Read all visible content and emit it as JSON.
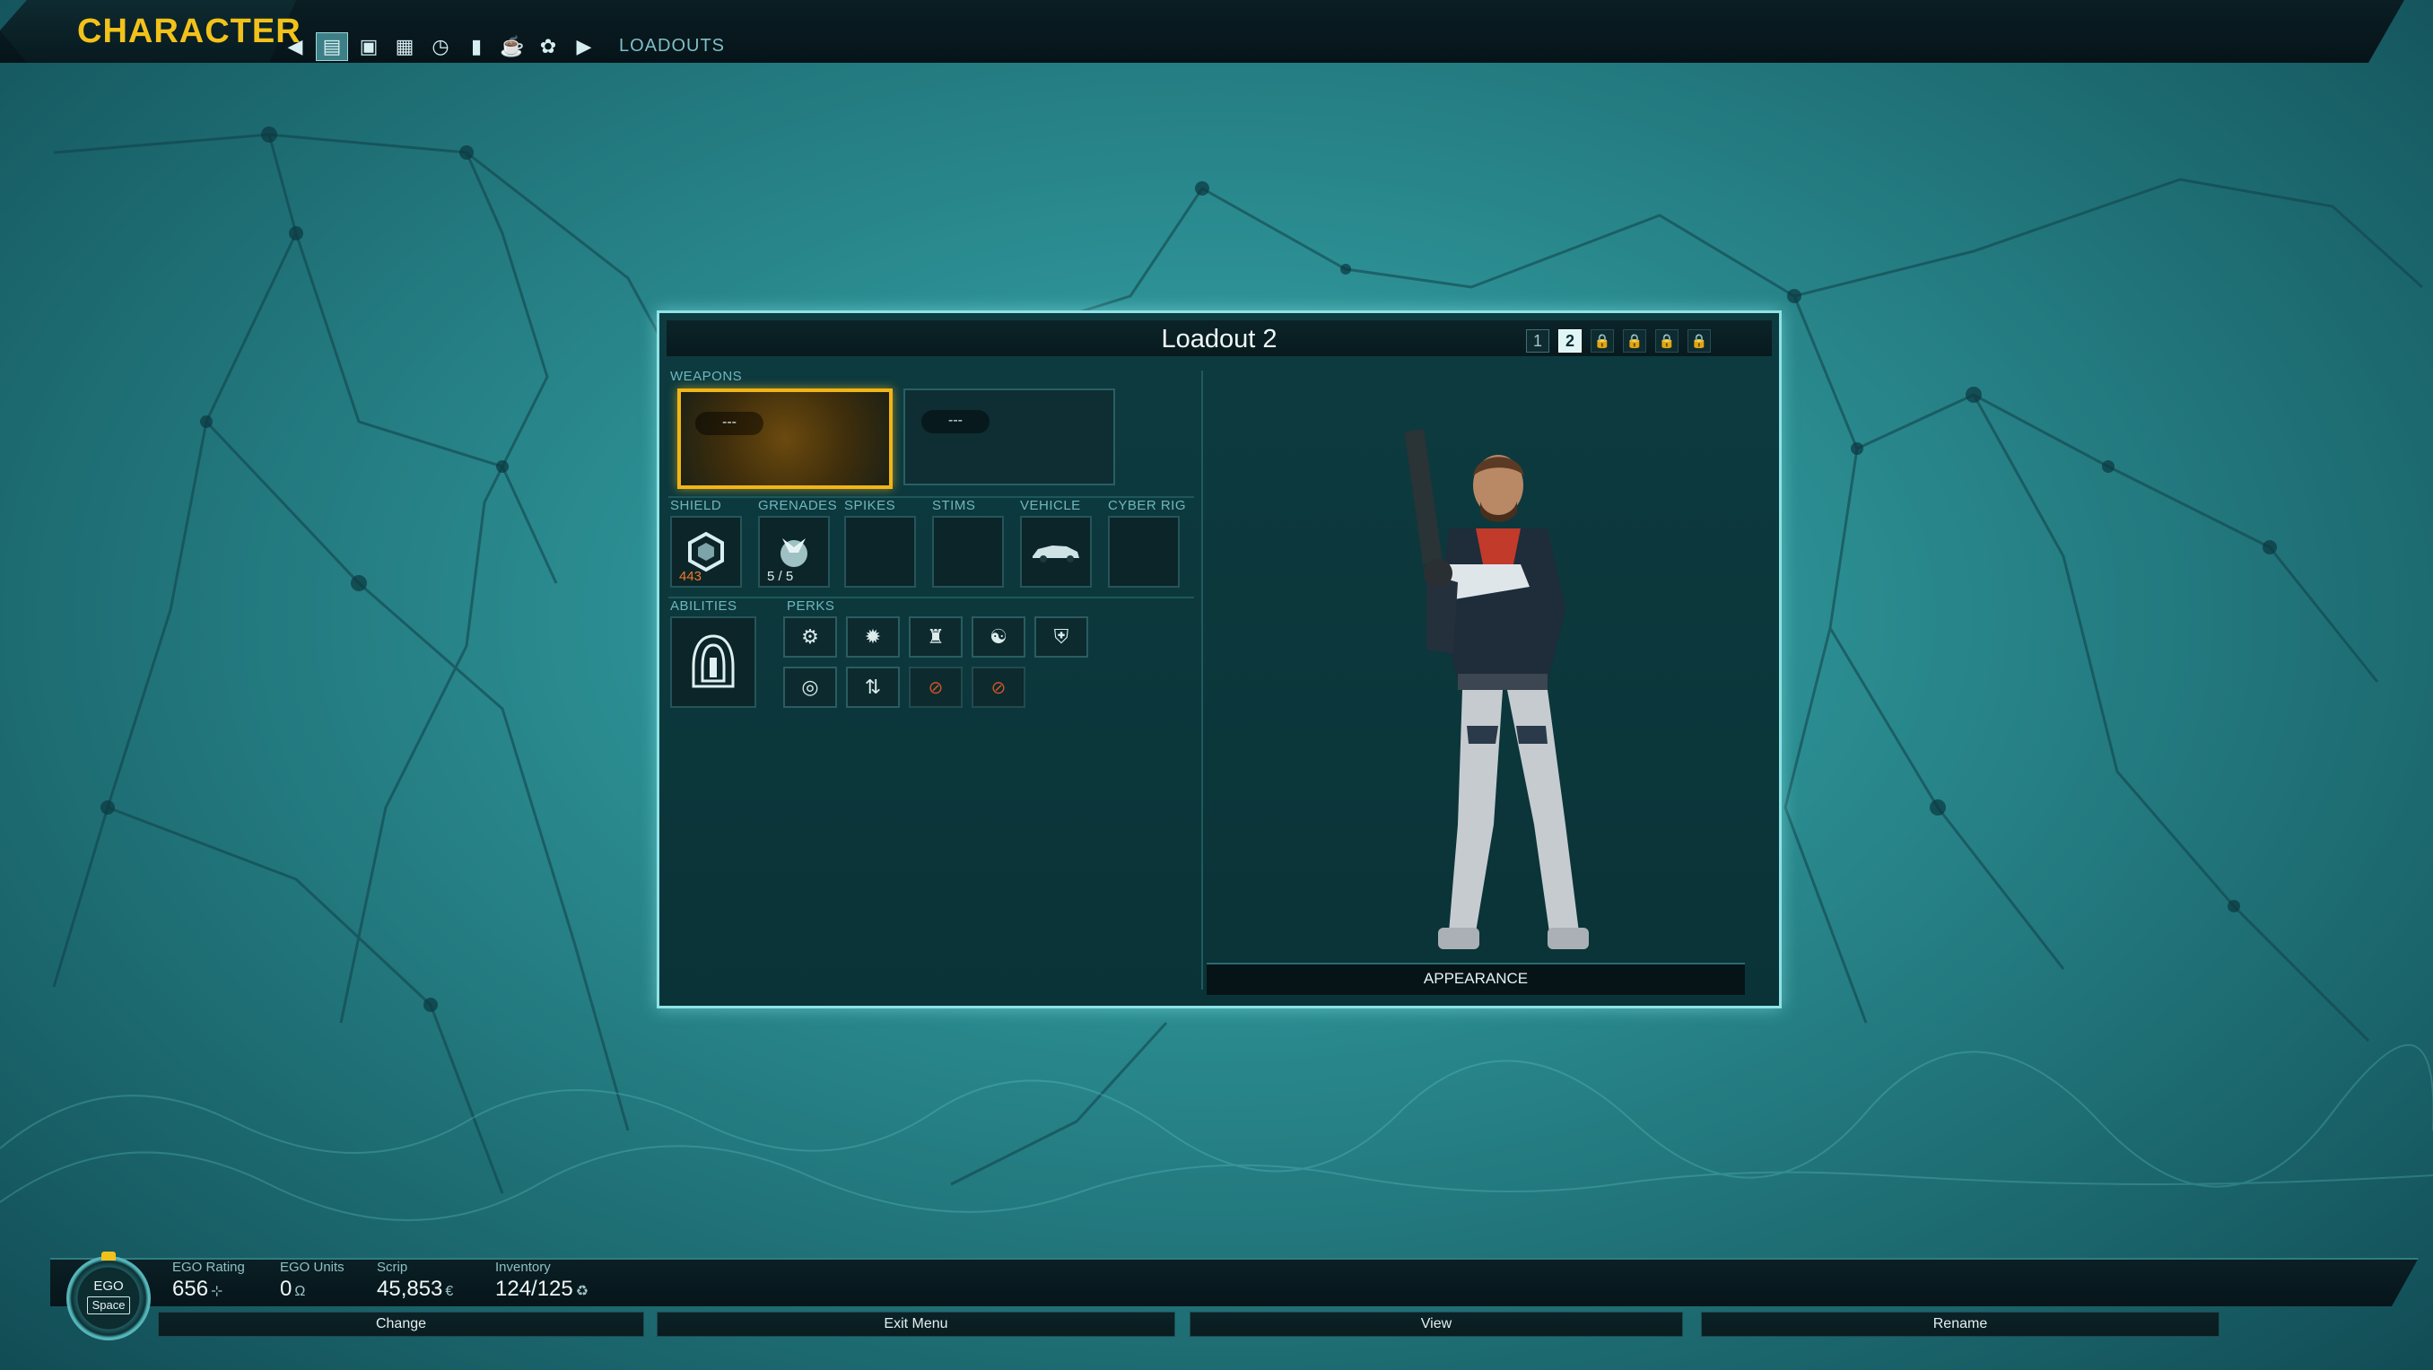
{
  "screen_title": "CHARACTER",
  "breadcrumb": "LOADOUTS",
  "nav_icons": [
    "back-arrow-icon",
    "loadouts-icon",
    "inventory-icon",
    "grid-icon",
    "gauge-icon",
    "stats-chart-icon",
    "trophy-icon",
    "badge-icon",
    "forward-arrow-icon"
  ],
  "panel": {
    "title": "Loadout 2",
    "tabs": [
      "1",
      "2"
    ],
    "selected_tab": "2",
    "locked_tab_count": 4
  },
  "sections": {
    "weapons": "WEAPONS",
    "shield": "SHIELD",
    "grenades": "GRENADES",
    "spikes": "SPIKES",
    "stims": "STIMS",
    "vehicle": "VEHICLE",
    "cyber_rig": "CYBER RIG",
    "abilities": "ABILITIES",
    "perks": "PERKS"
  },
  "weapons": [
    {
      "label": "---",
      "selected": true
    },
    {
      "label": "---",
      "selected": false
    }
  ],
  "gear": {
    "shield_value": "443",
    "grenades_count": "5 / 5"
  },
  "perk_icons": [
    "perk-gear-icon",
    "perk-burst-icon",
    "perk-tower-icon",
    "perk-figure-icon",
    "perk-shield-icon",
    "perk-target-icon",
    "perk-arrows-icon",
    "perk-locked-icon",
    "perk-locked-icon"
  ],
  "appearance_label": "APPEARANCE",
  "bottom": {
    "ego_label": "EGO",
    "ego_key": "Space",
    "stats": [
      {
        "label": "EGO Rating",
        "value": "656"
      },
      {
        "label": "EGO Units",
        "value": "0"
      },
      {
        "label": "Scrip",
        "value": "45,853"
      },
      {
        "label": "Inventory",
        "value": "124/125"
      }
    ],
    "actions": [
      "Change",
      "Exit Menu",
      "View",
      "Rename"
    ]
  },
  "colors": {
    "accent_yellow": "#f2c21b",
    "panel_border": "#8ee3e6",
    "background_teal": "#2b8d91"
  }
}
